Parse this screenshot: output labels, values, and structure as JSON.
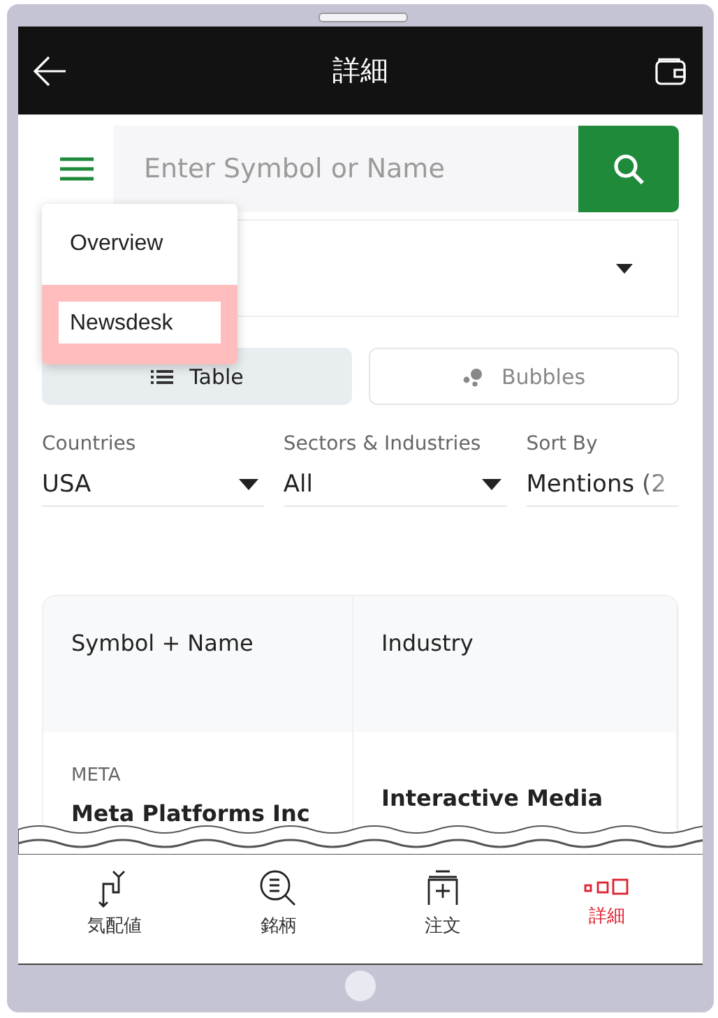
{
  "header": {
    "title": "詳細"
  },
  "search": {
    "placeholder": "Enter Symbol or Name"
  },
  "menu": {
    "items": [
      {
        "label": "Overview",
        "selected": false
      },
      {
        "label": "Newsdesk",
        "selected": true
      }
    ]
  },
  "view_tabs": [
    {
      "label": "Table",
      "selected": true
    },
    {
      "label": "Bubbles",
      "selected": false
    }
  ],
  "filters": [
    {
      "label": "Countries",
      "value": "USA"
    },
    {
      "label": "Sectors & Industries",
      "value": "All"
    },
    {
      "label": "Sort By",
      "value": "Mentions (2"
    }
  ],
  "table": {
    "columns": [
      "Symbol + Name",
      "Industry"
    ],
    "rows": [
      {
        "symbol": "META",
        "name": "Meta Platforms Inc",
        "industry": "Interactive Media"
      }
    ]
  },
  "bottom_nav": [
    {
      "label": "気配値",
      "selected": false
    },
    {
      "label": "銘柄",
      "selected": false
    },
    {
      "label": "注文",
      "selected": false
    },
    {
      "label": "詳細",
      "selected": true
    }
  ]
}
